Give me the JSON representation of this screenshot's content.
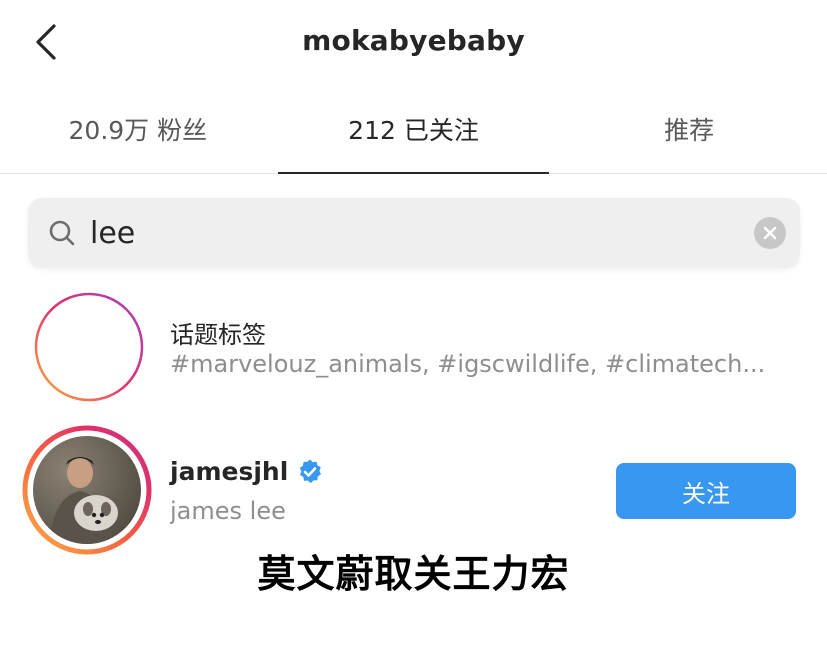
{
  "header": {
    "title": "mokabyebaby",
    "back_icon": "chevron-left-icon"
  },
  "tabs": [
    {
      "label": "20.9万 粉丝",
      "active": false
    },
    {
      "label": "212 已关注",
      "active": true
    },
    {
      "label": "推荐",
      "active": false
    }
  ],
  "search": {
    "value": "lee",
    "placeholder": "",
    "search_icon": "search-icon",
    "clear_icon": "clear-icon"
  },
  "results": {
    "hashtags": {
      "title": "话题标签",
      "subtitle": "#marvelouz_animals, #igscwildlife, #climatech...",
      "icon": "hashtag-icon"
    },
    "user": {
      "username": "jamesjhl",
      "full_name": "james lee",
      "verified": true,
      "follow_label": "关注"
    }
  },
  "overlay": {
    "caption": "莫文蔚取关王力宏"
  },
  "colors": {
    "accent": "#3897f0",
    "text_primary": "#262626",
    "text_secondary": "#8e8e8e",
    "search_bg": "#efefef"
  }
}
